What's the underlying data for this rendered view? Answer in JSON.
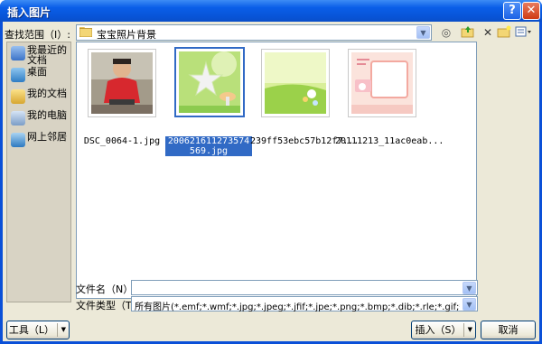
{
  "window": {
    "title": "插入图片",
    "help": "?",
    "close": "✕"
  },
  "look_in": {
    "label": "查找范围（I）:",
    "value": "宝宝照片背景"
  },
  "places": [
    {
      "label": "我最近的文档"
    },
    {
      "label": "桌面"
    },
    {
      "label": "我的文档"
    },
    {
      "label": "我的电脑"
    },
    {
      "label": "网上邻居"
    }
  ],
  "files": [
    {
      "name": "DSC_0064-1.jpg"
    },
    {
      "name": "20062161127357 4569.jpg",
      "display": "200621611273574569.jpg"
    },
    {
      "name": "239ff53ebc57b12f7..."
    },
    {
      "name": "20111213_11ac0eab..."
    }
  ],
  "file_name": {
    "label": "文件名（N）:",
    "value": ""
  },
  "file_type": {
    "label": "文件类型（T）:",
    "value": "所有图片(*.emf;*.wmf;*.jpg;*.jpeg;*.jfif;*.jpe;*.png;*.bmp;*.dib;*.rle;*.gif;*."
  },
  "buttons": {
    "tools": "工具（L）",
    "insert": "插入（S）",
    "cancel": "取消"
  },
  "colors": {
    "titlebar": "#0a5ee8",
    "selection": "#316ac5",
    "dialog_bg": "#ece9d8"
  }
}
